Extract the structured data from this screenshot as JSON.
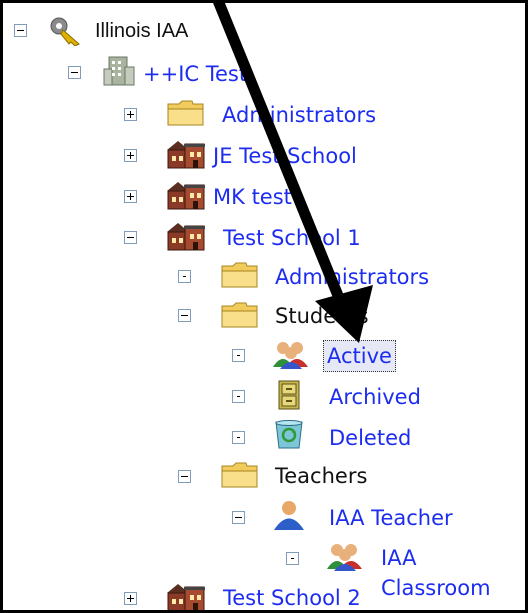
{
  "tree": {
    "root": {
      "label": "Illinois IAA",
      "expanded": true,
      "icon": "keys-icon"
    },
    "district": {
      "label": "++IC Test",
      "expanded": true,
      "icon": "building-icon"
    },
    "administrators_top": {
      "label": "Administrators",
      "expanded": false,
      "icon": "folder-icon"
    },
    "je_school": {
      "label": "JE Test School",
      "expanded": false,
      "icon": "school-icon"
    },
    "mk_test": {
      "label": "MK test",
      "expanded": false,
      "icon": "school-icon"
    },
    "school1": {
      "label": "Test School 1",
      "expanded": true,
      "icon": "school-icon"
    },
    "admins": {
      "label": "Administrators",
      "icon": "folder-icon"
    },
    "students": {
      "label": "Students",
      "expanded": true,
      "icon": "folder-icon"
    },
    "active": {
      "label": "Active",
      "selected": true,
      "icon": "users-icon"
    },
    "archived": {
      "label": "Archived",
      "icon": "cabinet-icon"
    },
    "deleted": {
      "label": "Deleted",
      "icon": "recycle-bin-icon"
    },
    "teachers": {
      "label": "Teachers",
      "expanded": true,
      "icon": "folder-icon"
    },
    "teacher": {
      "label": "IAA Teacher",
      "expanded": true,
      "icon": "user-icon"
    },
    "classroom": {
      "label": "IAA Classroom",
      "icon": "users-icon"
    },
    "school2": {
      "label": "Test School 2",
      "expanded": false,
      "icon": "school-icon"
    }
  },
  "colors": {
    "link": "#1d2df0",
    "selection_bg": "#e6e9f5",
    "folder": "#f5d36b"
  }
}
